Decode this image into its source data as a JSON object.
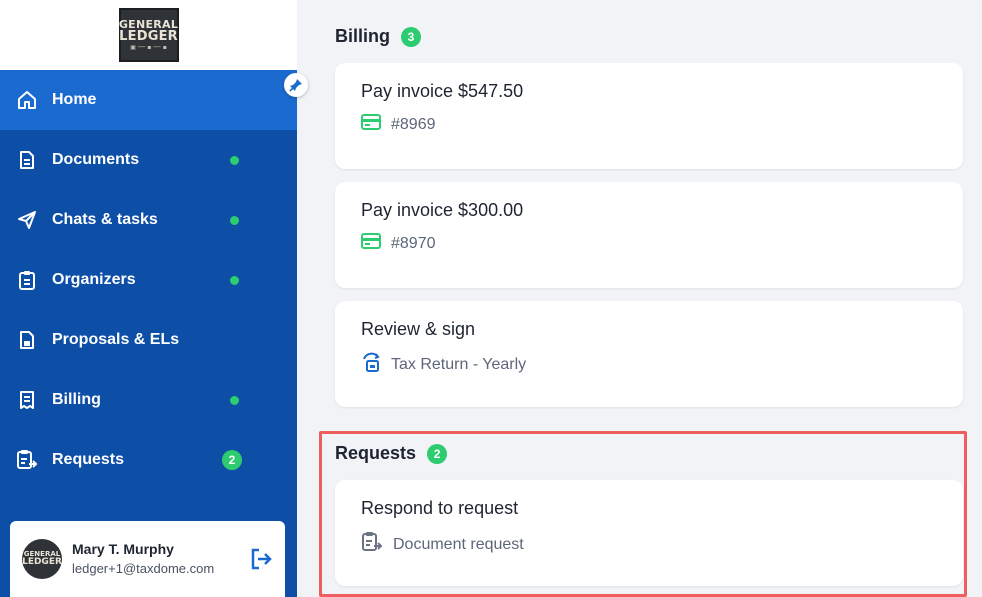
{
  "logo": {
    "line1": "GENERAL",
    "line2": "LEDGER"
  },
  "nav": [
    {
      "label": "Home",
      "icon": "home-icon",
      "active": true,
      "indicator": "none"
    },
    {
      "label": "Documents",
      "icon": "document-icon",
      "active": false,
      "indicator": "dot"
    },
    {
      "label": "Chats & tasks",
      "icon": "send-icon",
      "active": false,
      "indicator": "dot"
    },
    {
      "label": "Organizers",
      "icon": "clipboard-icon",
      "active": false,
      "indicator": "dot"
    },
    {
      "label": "Proposals & ELs",
      "icon": "proposal-icon",
      "active": false,
      "indicator": "none"
    },
    {
      "label": "Billing",
      "icon": "receipt-icon",
      "active": false,
      "indicator": "dot"
    },
    {
      "label": "Requests",
      "icon": "request-icon",
      "active": false,
      "indicator": "count",
      "count": "2"
    }
  ],
  "user": {
    "name": "Mary T. Murphy",
    "email": "ledger+1@taxdome.com",
    "avatar_line1": "GENERAL",
    "avatar_line2": "LEDGER"
  },
  "billing": {
    "title": "Billing",
    "count": "3",
    "cards": [
      {
        "title": "Pay invoice $547.50",
        "sub": "#8969",
        "icon": "credit-card-icon"
      },
      {
        "title": "Pay invoice $300.00",
        "sub": "#8970",
        "icon": "credit-card-icon"
      },
      {
        "title": "Review & sign",
        "sub": "Tax Return - Yearly",
        "icon": "sign-document-icon"
      }
    ]
  },
  "requests": {
    "title": "Requests",
    "count": "2",
    "cards": [
      {
        "title": "Respond to request",
        "sub": "Document request",
        "icon": "request-icon"
      }
    ]
  },
  "colors": {
    "sidebar": "#0d4ea6",
    "sidebar_active": "#1b6acf",
    "accent_green": "#2ecc71",
    "highlight": "#ef5e5e",
    "background": "#f1f3f7"
  }
}
